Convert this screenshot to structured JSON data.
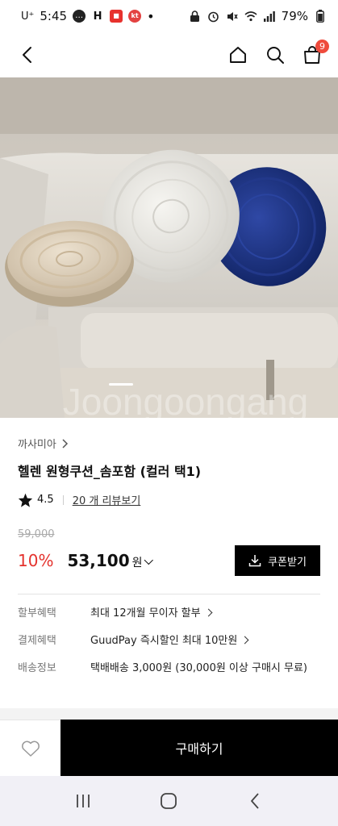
{
  "status_bar": {
    "carrier": "U⁺",
    "time": "5:45",
    "battery": "79%",
    "left_icons": [
      "chat-icon",
      "h-icon",
      "app-icon",
      "kt-icon",
      "dot-icon"
    ],
    "right_icons": [
      "lock-icon",
      "alarm-icon",
      "mute-icon",
      "wifi-icon",
      "signal-icon",
      "battery-icon"
    ]
  },
  "nav": {
    "back_icon": "chevron-left-icon",
    "home_icon": "home-icon",
    "search_icon": "search-icon",
    "cart_icon": "shopping-bag-icon",
    "cart_count": "9",
    "badge_color": "#ef4b3c"
  },
  "hero": {
    "watermark": "Joongoongang",
    "slide_indicator": "active"
  },
  "product": {
    "brand": "까사미아",
    "title": "헬렌 원형쿠션_솜포함 (컬러 택1)",
    "rating": "4.5",
    "review_link": "20 개 리뷰보기",
    "original_price": "59,000",
    "discount": "10%",
    "price": "53,100",
    "currency": "원",
    "coupon_label": "쿠폰받기",
    "discount_color": "#e4322d"
  },
  "benefits": [
    {
      "label": "할부혜택",
      "value": "최대 12개월 무이자 할부",
      "has_chevron": true
    },
    {
      "label": "결제혜택",
      "value": "GuudPay 즉시할인 최대 10만원",
      "has_chevron": true
    },
    {
      "label": "배송정보",
      "value": "택배배송 3,000원 (30,000원 이상 구매시 무료)",
      "has_chevron": false
    }
  ],
  "bottom_bar": {
    "wishlist_icon": "heart-icon",
    "buy_label": "구매하기"
  },
  "android_nav": {
    "recents_icon": "recents-icon",
    "home_icon": "home-circle-icon",
    "back_icon": "back-chevron-icon"
  }
}
